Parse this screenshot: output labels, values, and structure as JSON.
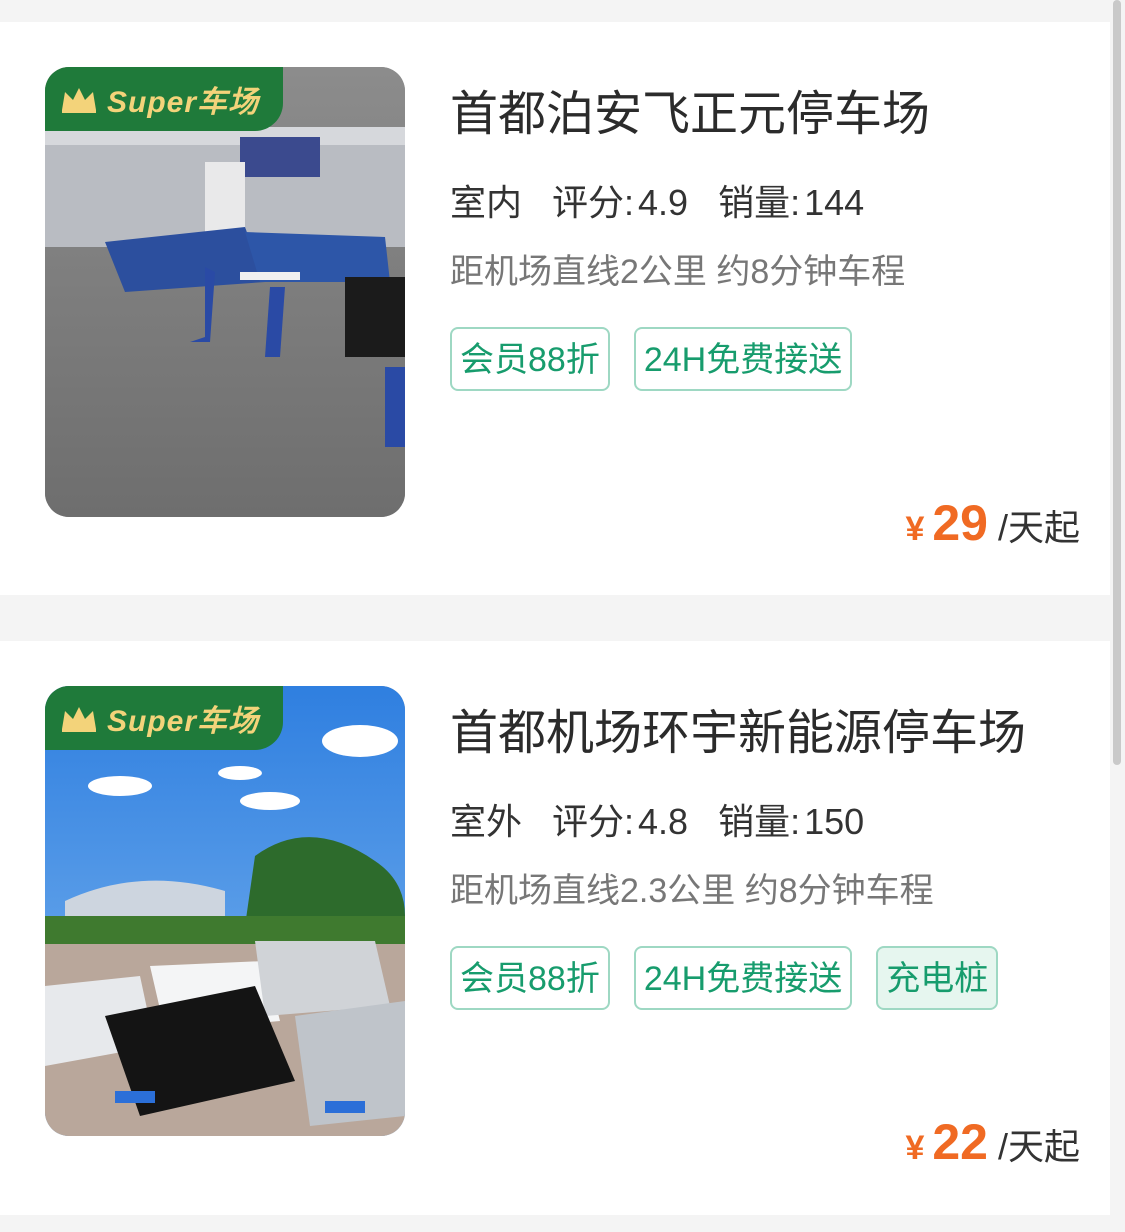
{
  "listings": [
    {
      "badge": "Super车场",
      "title": "首都泊安飞正元停车场",
      "type": "室内",
      "rating_label": "评分:",
      "rating": "4.9",
      "sales_label": "销量:",
      "sales": "144",
      "distance": "距机场直线2公里 约8分钟车程",
      "tags": [
        "会员88折",
        "24H免费接送"
      ],
      "currency": "¥",
      "price": "29",
      "unit": "/天起",
      "image": "indoor-parking-garage-photo"
    },
    {
      "badge": "Super车场",
      "title": "首都机场环宇新能源停车场",
      "type": "室外",
      "rating_label": "评分:",
      "rating": "4.8",
      "sales_label": "销量:",
      "sales": "150",
      "distance": "距机场直线2.3公里 约8分钟车程",
      "tags": [
        "会员88折",
        "24H免费接送",
        "充电桩"
      ],
      "currency": "¥",
      "price": "22",
      "unit": "/天起",
      "image": "outdoor-parking-lot-photo"
    }
  ],
  "colors": {
    "accent_green": "#179c6d",
    "badge_green": "#1f7a3a",
    "badge_gold": "#f3d37a",
    "price_orange": "#f06a23"
  }
}
